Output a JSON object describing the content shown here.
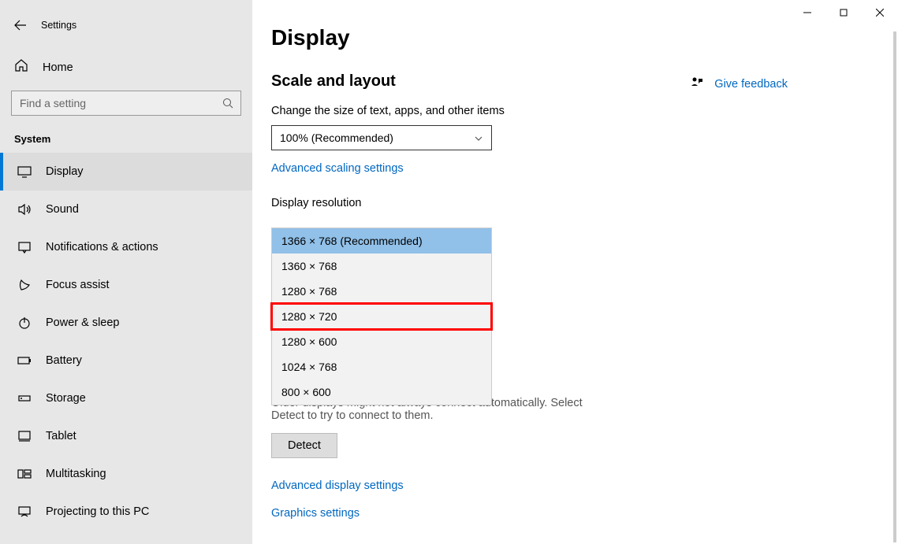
{
  "app_title": "Settings",
  "search": {
    "placeholder": "Find a setting"
  },
  "sidebar": {
    "home_label": "Home",
    "category": "System",
    "items": [
      {
        "label": "Display",
        "active": true
      },
      {
        "label": "Sound"
      },
      {
        "label": "Notifications & actions"
      },
      {
        "label": "Focus assist"
      },
      {
        "label": "Power & sleep"
      },
      {
        "label": "Battery"
      },
      {
        "label": "Storage"
      },
      {
        "label": "Tablet"
      },
      {
        "label": "Multitasking"
      },
      {
        "label": "Projecting to this PC"
      }
    ]
  },
  "feedback_label": "Give feedback",
  "main": {
    "title": "Display",
    "section1": "Scale and layout",
    "scale_label": "Change the size of text, apps, and other items",
    "scale_value": "100% (Recommended)",
    "adv_scaling_link": "Advanced scaling settings",
    "resolution_label": "Display resolution",
    "resolution_options": [
      {
        "label": "1366 × 768 (Recommended)",
        "selected": true
      },
      {
        "label": "1360 × 768"
      },
      {
        "label": "1280 × 768"
      },
      {
        "label": "1280 × 720",
        "highlight": true
      },
      {
        "label": "1280 × 600"
      },
      {
        "label": "1024 × 768"
      },
      {
        "label": "800 × 600"
      }
    ],
    "detect_para": "Older displays might not always connect automatically. Select Detect to try to connect to them.",
    "detect_btn": "Detect",
    "adv_display_link": "Advanced display settings",
    "graphics_link": "Graphics settings"
  }
}
